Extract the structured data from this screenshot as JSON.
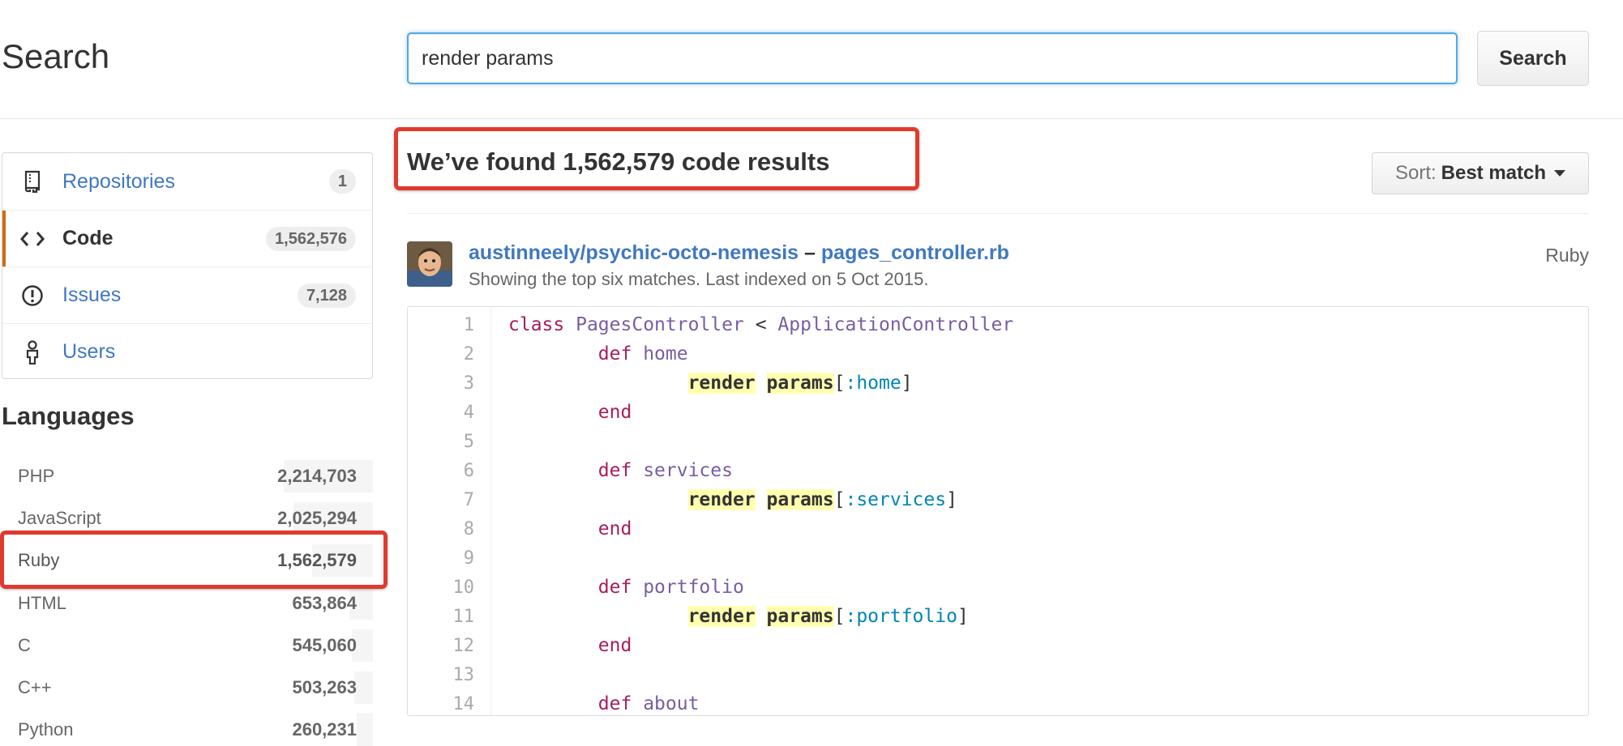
{
  "header": {
    "title": "Search",
    "search_value": "render params",
    "search_button_label": "Search"
  },
  "menu": {
    "items": [
      {
        "label": "Repositories",
        "count": "1",
        "icon": "repo-icon"
      },
      {
        "label": "Code",
        "count": "1,562,576",
        "icon": "code-icon",
        "selected": true
      },
      {
        "label": "Issues",
        "count": "7,128",
        "icon": "issue-icon"
      },
      {
        "label": "Users",
        "count": "",
        "icon": "person-icon"
      }
    ]
  },
  "languages": {
    "heading": "Languages",
    "items": [
      {
        "name": "PHP",
        "count": "2,214,703",
        "share": 0.19
      },
      {
        "name": "JavaScript",
        "count": "2,025,294",
        "share": 0.17
      },
      {
        "name": "Ruby",
        "count": "1,562,579",
        "share": 0.13
      },
      {
        "name": "HTML",
        "count": "653,864",
        "share": 0.05
      },
      {
        "name": "C",
        "count": "545,060",
        "share": 0.045
      },
      {
        "name": "C++",
        "count": "503,263",
        "share": 0.04
      },
      {
        "name": "Python",
        "count": "260,231",
        "share": 0.035
      }
    ]
  },
  "results": {
    "title": "We’ve found 1,562,579 code results",
    "sort_label": "Sort:",
    "sort_value": "Best match",
    "items": [
      {
        "repo": "austinneely/psychic-octo-nemesis",
        "separator": "–",
        "file": "pages_controller.rb",
        "meta": "Showing the top six matches. Last indexed on 5 Oct 2015.",
        "language": "Ruby",
        "line_numbers": [
          "1",
          "2",
          "3",
          "4",
          "5",
          "6",
          "7",
          "8",
          "9",
          "10",
          "11",
          "12",
          "13",
          "14"
        ]
      }
    ]
  },
  "code_tokens": {
    "l1_kw": "class",
    "l1_name": "PagesController",
    "l1_op": "<",
    "l1_parent": "ApplicationController",
    "def": "def",
    "end": "end",
    "render": "render",
    "params": "params",
    "home": "home",
    "services": "services",
    "portfolio": "portfolio",
    "about": "about",
    "sym_home": ":home",
    "sym_services": ":services",
    "sym_portfolio": ":portfolio",
    "lbracket": "[",
    "rbracket": "]"
  },
  "colors": {
    "link": "#4078c0",
    "selected_accent": "#d26911",
    "highlight": "#ffffb0",
    "annotation": "#e03a2f"
  }
}
